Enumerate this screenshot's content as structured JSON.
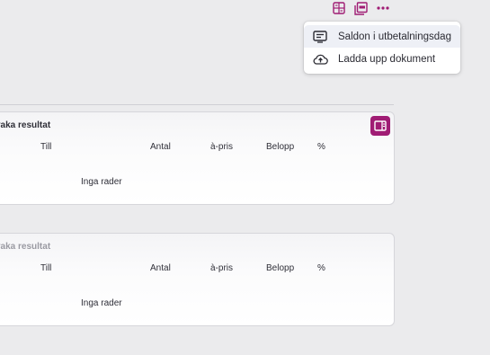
{
  "colors": {
    "accent": "#a01c74",
    "background": "#ebebed",
    "panel": "#ffffff"
  },
  "toolbar": {
    "icons": [
      "report-icon",
      "pdf-icon",
      "more-icon"
    ]
  },
  "menu": {
    "items": [
      {
        "label": "Saldon i utbetalningsdag",
        "icon": "receipt-icon"
      },
      {
        "label": "Ladda upp dokument",
        "icon": "cloud-upload-icon"
      }
    ]
  },
  "panels": [
    {
      "title": "vaka resultat",
      "columns": [
        "Till",
        "Antal",
        "à-pris",
        "Belopp",
        "%"
      ],
      "empty_text": "Inga rader"
    },
    {
      "title": "vaka resultat",
      "columns": [
        "Till",
        "Antal",
        "à-pris",
        "Belopp",
        "%"
      ],
      "empty_text": "Inga rader"
    }
  ]
}
